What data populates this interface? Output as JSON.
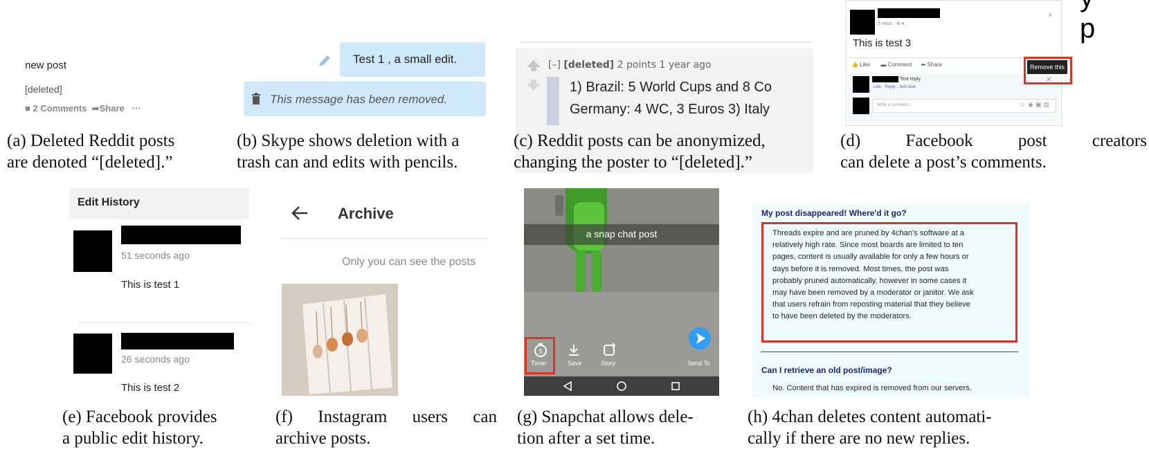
{
  "panel_a": {
    "post_title": "new post",
    "deleted_label": "[deleted]",
    "comments_label": "2 Comments",
    "share_label": "Share",
    "more_label": "···",
    "caption_line1": "(a) Deleted Reddit posts",
    "caption_line2": "are denoted “[deleted].”"
  },
  "panel_b": {
    "edited_message": "Test 1 , a small edit.",
    "removed_message": "This message has been removed.",
    "caption_line1": "(b) Skype shows deletion with a",
    "caption_line2": "trash can and edits with pencils."
  },
  "panel_c": {
    "collapse_label": "[–]",
    "author": "[deleted]",
    "meta": "2 points 1 year ago",
    "comment_line1": "1) Brazil: 5 World Cups and 8 Co",
    "comment_line2": "Germany: 4 WC, 3 Euros 3) Italy",
    "caption_line1": "(c) Reddit posts can be anonymized,",
    "caption_line2": "changing the poster to “[deleted].”"
  },
  "panel_d": {
    "timestamp": "5 mins · ⊕ ▾",
    "post_text": "This is test 3",
    "like_label": "Like",
    "comment_label": "Comment",
    "share_label": "Share",
    "remove_label": "Remove this",
    "reply_text": "Test reply",
    "reply_meta": "Like · Reply · Just now",
    "write_placeholder": "Write a comment...",
    "caption_line1": "(d) Facebook post creators",
    "caption_line2": "can delete a post’s comments."
  },
  "panel_e": {
    "header": "Edit History",
    "entry1_time": "51 seconds ago",
    "entry1_text": "This is test 1",
    "entry2_time": "26 seconds ago",
    "entry2_text": "This is test 2",
    "caption_line1": "(e) Facebook provides",
    "caption_line2": "a public edit history."
  },
  "panel_f": {
    "title": "Archive",
    "note": "Only you can see the posts",
    "caption_line1": "(f) Instagram users can",
    "caption_line2": "archive posts."
  },
  "panel_g": {
    "caption_overlay": "a snap chat post",
    "timer_label": "Timer",
    "save_label": "Save",
    "story_label": "Story",
    "send_label": "Send To",
    "caption_line1": "(g) Snapchat allows dele-",
    "caption_line2": "tion after a set time."
  },
  "panel_h": {
    "question1": "My post disappeared! Where'd it go?",
    "answer1_lines": [
      "Threads expire and are pruned by 4chan's software at a",
      "relatively high rate. Since most boards are limited to ten",
      "pages, content is usually available for only a few hours or",
      "days before it is removed. Most times, the post was",
      "probably pruned automatically, however in some cases it",
      "may have been removed by a moderator or janitor. We ask",
      "that users refrain from reposting material that they believe",
      "to have been deleted by the moderators."
    ],
    "question2": "Can I retrieve an old post/image?",
    "answer2": "No. Content that has expired is removed from our servers.",
    "caption_line1": "(h) 4chan deletes content automati-",
    "caption_line2": "cally if there are no new replies."
  },
  "colors": {
    "highlight_red": "#e0321e",
    "skype_bubble": "#cfe9fa",
    "fourchan_bg": "#f0fbff",
    "fourchan_heading": "#1a237e",
    "snapchat_send": "#2f9df4"
  }
}
